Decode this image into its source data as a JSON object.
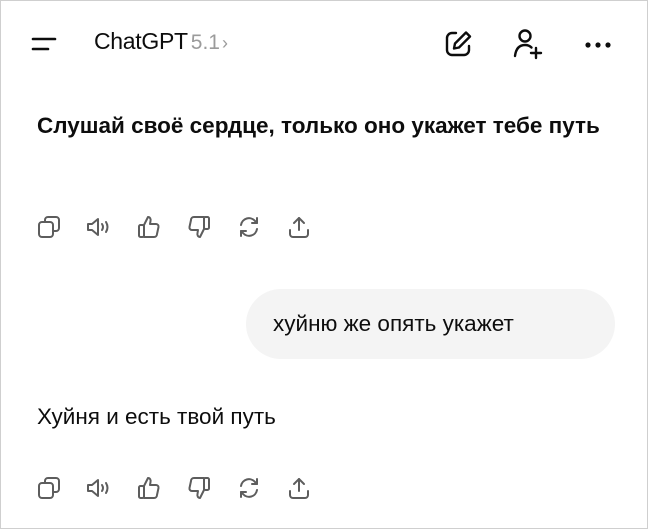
{
  "header": {
    "menu_icon": "menu-icon",
    "title": "ChatGPT",
    "version": "5.1",
    "chevron": "›",
    "new_chat_icon": "edit-icon",
    "add_person_icon": "add-person-icon",
    "more_icon": "more-icon"
  },
  "messages": [
    {
      "role": "assistant",
      "text": "Слушай своё сердце, только оно укажет тебе путь",
      "bold": true
    },
    {
      "role": "user",
      "text": "хуйню же опять укажет"
    },
    {
      "role": "assistant",
      "text": "Хуйня и есть твой путь",
      "bold": false
    }
  ],
  "message_actions": [
    "copy-icon",
    "read-aloud-icon",
    "thumbs-up-icon",
    "thumbs-down-icon",
    "regenerate-icon",
    "share-icon"
  ],
  "colors": {
    "text": "#0d0d0d",
    "muted": "#9b9b9b",
    "bubble": "#f4f4f4",
    "icon": "#5d5d5d"
  }
}
